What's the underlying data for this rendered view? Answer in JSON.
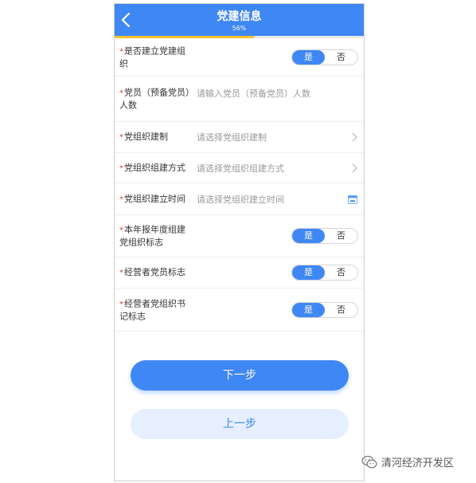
{
  "header": {
    "title": "党建信息",
    "progress_text": "56%",
    "progress": 0.56
  },
  "form": {
    "rows": [
      {
        "label": "是否建立党建组织",
        "type": "toggle",
        "yes": "是",
        "no": "否"
      },
      {
        "label": "党员（预备党员）人数",
        "type": "input",
        "placeholder": "请输入党员（预备党员）人数"
      },
      {
        "label": "党组织建制",
        "type": "select",
        "placeholder": "请选择党组织建制"
      },
      {
        "label": "党组织组建方式",
        "type": "select",
        "placeholder": "请选择党组织组建方式"
      },
      {
        "label": "党组织建立时间",
        "type": "date",
        "placeholder": "请选择党组织建立时间"
      },
      {
        "label": "本年报年度组建党组织标志",
        "type": "toggle",
        "yes": "是",
        "no": "否"
      },
      {
        "label": "经营者党员标志",
        "type": "toggle",
        "yes": "是",
        "no": "否"
      },
      {
        "label": "经营者党组织书记标志",
        "type": "toggle",
        "yes": "是",
        "no": "否"
      }
    ],
    "required_mark": "*"
  },
  "buttons": {
    "next": "下一步",
    "prev": "上一步"
  },
  "watermark": {
    "text": "清河经济开发区",
    "icon": "wechat-icon"
  },
  "colors": {
    "primary": "#3f87f5",
    "progress": "#f2c430",
    "required": "#e53935"
  }
}
